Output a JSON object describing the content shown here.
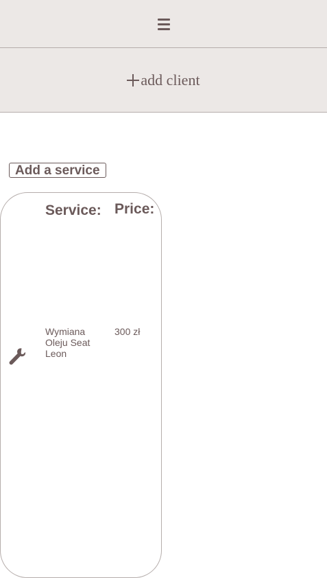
{
  "header": {
    "menu_icon": "hamburger-icon"
  },
  "addbar": {
    "icon": "plus-icon",
    "label": "add client"
  },
  "add_service_button": "Add a service",
  "service_table": {
    "columns": [
      "Service:",
      "Price:"
    ],
    "rows": [
      {
        "icon": "wrench-icon",
        "service": "Wymiana Oleju Seat Leon",
        "price": "300 zł"
      }
    ]
  },
  "colors": {
    "text": "#6b5a5a",
    "bar_background": "#ece8e6",
    "border": "#b5adab"
  }
}
